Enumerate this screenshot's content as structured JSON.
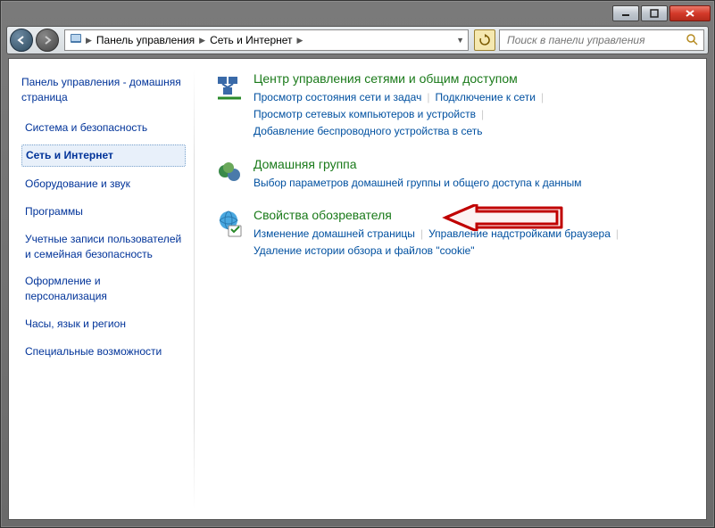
{
  "titlebar": {},
  "address": {
    "root_icon": "control-panel",
    "crumbs": [
      "Панель управления",
      "Сеть и Интернет"
    ]
  },
  "search": {
    "placeholder": "Поиск в панели управления"
  },
  "sidebar": {
    "home": "Панель управления - домашняя страница",
    "items": [
      {
        "label": "Система и безопасность",
        "active": false
      },
      {
        "label": "Сеть и Интернет",
        "active": true
      },
      {
        "label": "Оборудование и звук",
        "active": false
      },
      {
        "label": "Программы",
        "active": false
      },
      {
        "label": "Учетные записи пользователей и семейная безопасность",
        "active": false
      },
      {
        "label": "Оформление и персонализация",
        "active": false
      },
      {
        "label": "Часы, язык и регион",
        "active": false
      },
      {
        "label": "Специальные возможности",
        "active": false
      }
    ]
  },
  "sections": [
    {
      "icon": "network-sharing",
      "title": "Центр управления сетями и общим доступом",
      "links": [
        "Просмотр состояния сети и задач",
        "Подключение к сети",
        "Просмотр сетевых компьютеров и устройств",
        "Добавление беспроводного устройства в сеть"
      ]
    },
    {
      "icon": "homegroup",
      "title": "Домашняя группа",
      "links": [
        "Выбор параметров домашней группы и общего доступа к данным"
      ]
    },
    {
      "icon": "internet-options",
      "title": "Свойства обозревателя",
      "links": [
        "Изменение домашней страницы",
        "Управление надстройками браузера",
        "Удаление истории обзора и файлов \"cookie\""
      ],
      "highlighted": true
    }
  ]
}
